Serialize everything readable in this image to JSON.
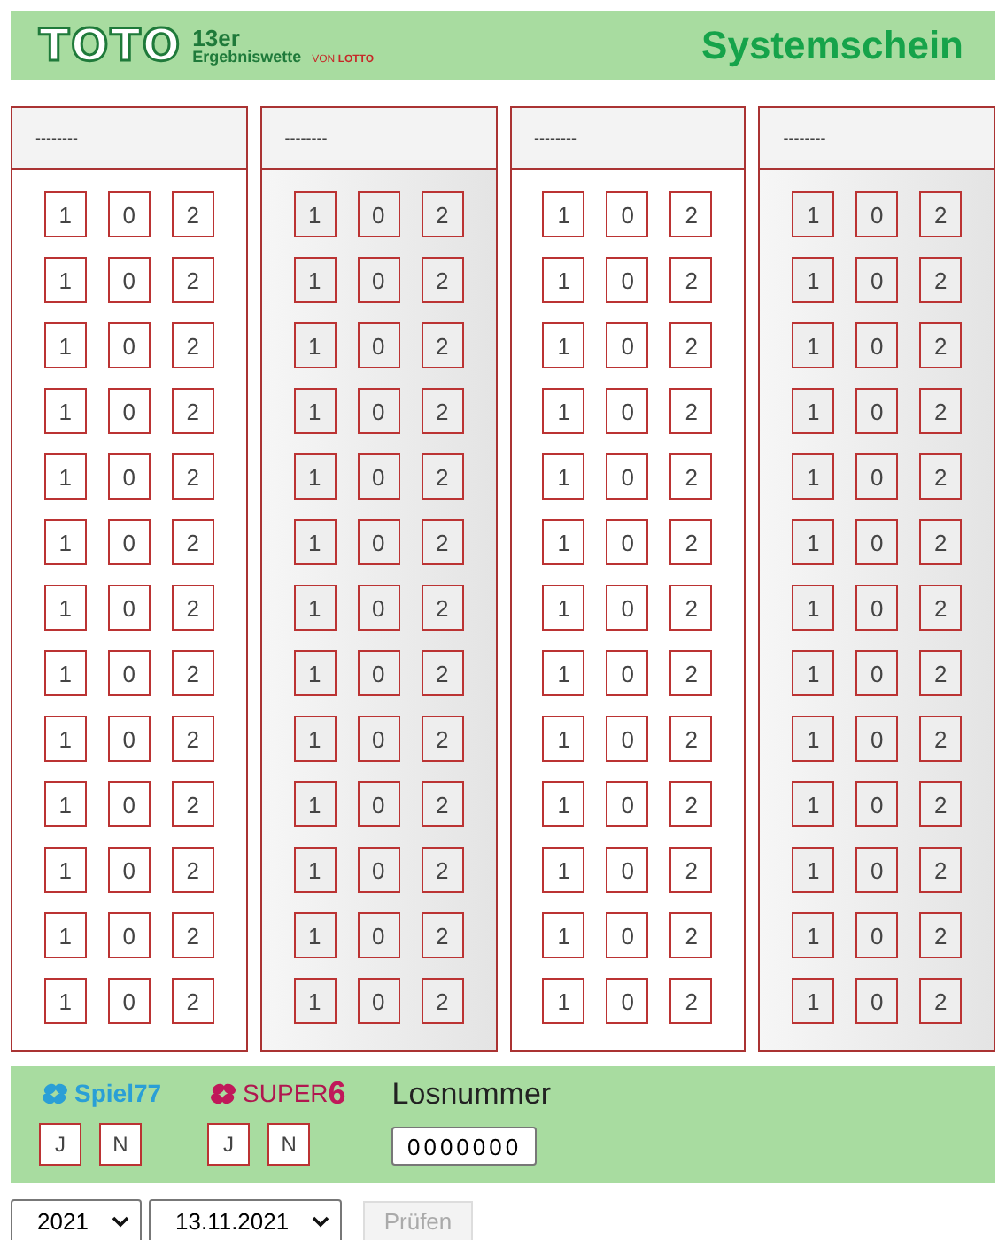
{
  "header": {
    "logo_word": "TOTO",
    "logo_number": "13er",
    "logo_subtitle": "Ergebniswette",
    "logo_from": "VON",
    "logo_brand": "LOTTO",
    "title": "Systemschein"
  },
  "columns": [
    {
      "header": "--------",
      "shaded": false,
      "rows": [
        [
          "1",
          "0",
          "2"
        ],
        [
          "1",
          "0",
          "2"
        ],
        [
          "1",
          "0",
          "2"
        ],
        [
          "1",
          "0",
          "2"
        ],
        [
          "1",
          "0",
          "2"
        ],
        [
          "1",
          "0",
          "2"
        ],
        [
          "1",
          "0",
          "2"
        ],
        [
          "1",
          "0",
          "2"
        ],
        [
          "1",
          "0",
          "2"
        ],
        [
          "1",
          "0",
          "2"
        ],
        [
          "1",
          "0",
          "2"
        ],
        [
          "1",
          "0",
          "2"
        ],
        [
          "1",
          "0",
          "2"
        ]
      ]
    },
    {
      "header": "--------",
      "shaded": true,
      "rows": [
        [
          "1",
          "0",
          "2"
        ],
        [
          "1",
          "0",
          "2"
        ],
        [
          "1",
          "0",
          "2"
        ],
        [
          "1",
          "0",
          "2"
        ],
        [
          "1",
          "0",
          "2"
        ],
        [
          "1",
          "0",
          "2"
        ],
        [
          "1",
          "0",
          "2"
        ],
        [
          "1",
          "0",
          "2"
        ],
        [
          "1",
          "0",
          "2"
        ],
        [
          "1",
          "0",
          "2"
        ],
        [
          "1",
          "0",
          "2"
        ],
        [
          "1",
          "0",
          "2"
        ],
        [
          "1",
          "0",
          "2"
        ]
      ]
    },
    {
      "header": "--------",
      "shaded": false,
      "rows": [
        [
          "1",
          "0",
          "2"
        ],
        [
          "1",
          "0",
          "2"
        ],
        [
          "1",
          "0",
          "2"
        ],
        [
          "1",
          "0",
          "2"
        ],
        [
          "1",
          "0",
          "2"
        ],
        [
          "1",
          "0",
          "2"
        ],
        [
          "1",
          "0",
          "2"
        ],
        [
          "1",
          "0",
          "2"
        ],
        [
          "1",
          "0",
          "2"
        ],
        [
          "1",
          "0",
          "2"
        ],
        [
          "1",
          "0",
          "2"
        ],
        [
          "1",
          "0",
          "2"
        ],
        [
          "1",
          "0",
          "2"
        ]
      ]
    },
    {
      "header": "--------",
      "shaded": true,
      "rows": [
        [
          "1",
          "0",
          "2"
        ],
        [
          "1",
          "0",
          "2"
        ],
        [
          "1",
          "0",
          "2"
        ],
        [
          "1",
          "0",
          "2"
        ],
        [
          "1",
          "0",
          "2"
        ],
        [
          "1",
          "0",
          "2"
        ],
        [
          "1",
          "0",
          "2"
        ],
        [
          "1",
          "0",
          "2"
        ],
        [
          "1",
          "0",
          "2"
        ],
        [
          "1",
          "0",
          "2"
        ],
        [
          "1",
          "0",
          "2"
        ],
        [
          "1",
          "0",
          "2"
        ],
        [
          "1",
          "0",
          "2"
        ]
      ]
    }
  ],
  "extras": [
    {
      "kind": "spiel77",
      "name": "Spiel",
      "number": "77",
      "options": [
        "J",
        "N"
      ]
    },
    {
      "kind": "super6",
      "name": "SUPER",
      "number": "6",
      "options": [
        "J",
        "N"
      ]
    }
  ],
  "ticket": {
    "label": "Losnummer",
    "value": "0000000"
  },
  "controls": {
    "year": "2021",
    "date": "13.11.2021",
    "check_button": {
      "label": "Prüfen",
      "disabled": true
    }
  }
}
